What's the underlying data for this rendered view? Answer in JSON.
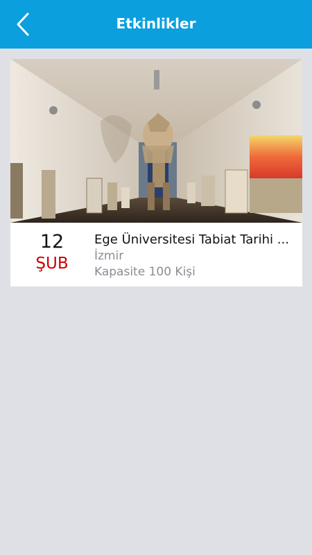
{
  "header": {
    "title": "Etkinlikler",
    "back_icon": "chevron-left-icon",
    "background_color": "#0b9fde"
  },
  "events": [
    {
      "day": "12",
      "month": "ŞUB",
      "title": "Ege Üniversitesi Tabiat Tarihi ...",
      "city": "İzmir",
      "capacity": "Kapasite 100 Kişi",
      "month_color": "#cc0000"
    }
  ]
}
